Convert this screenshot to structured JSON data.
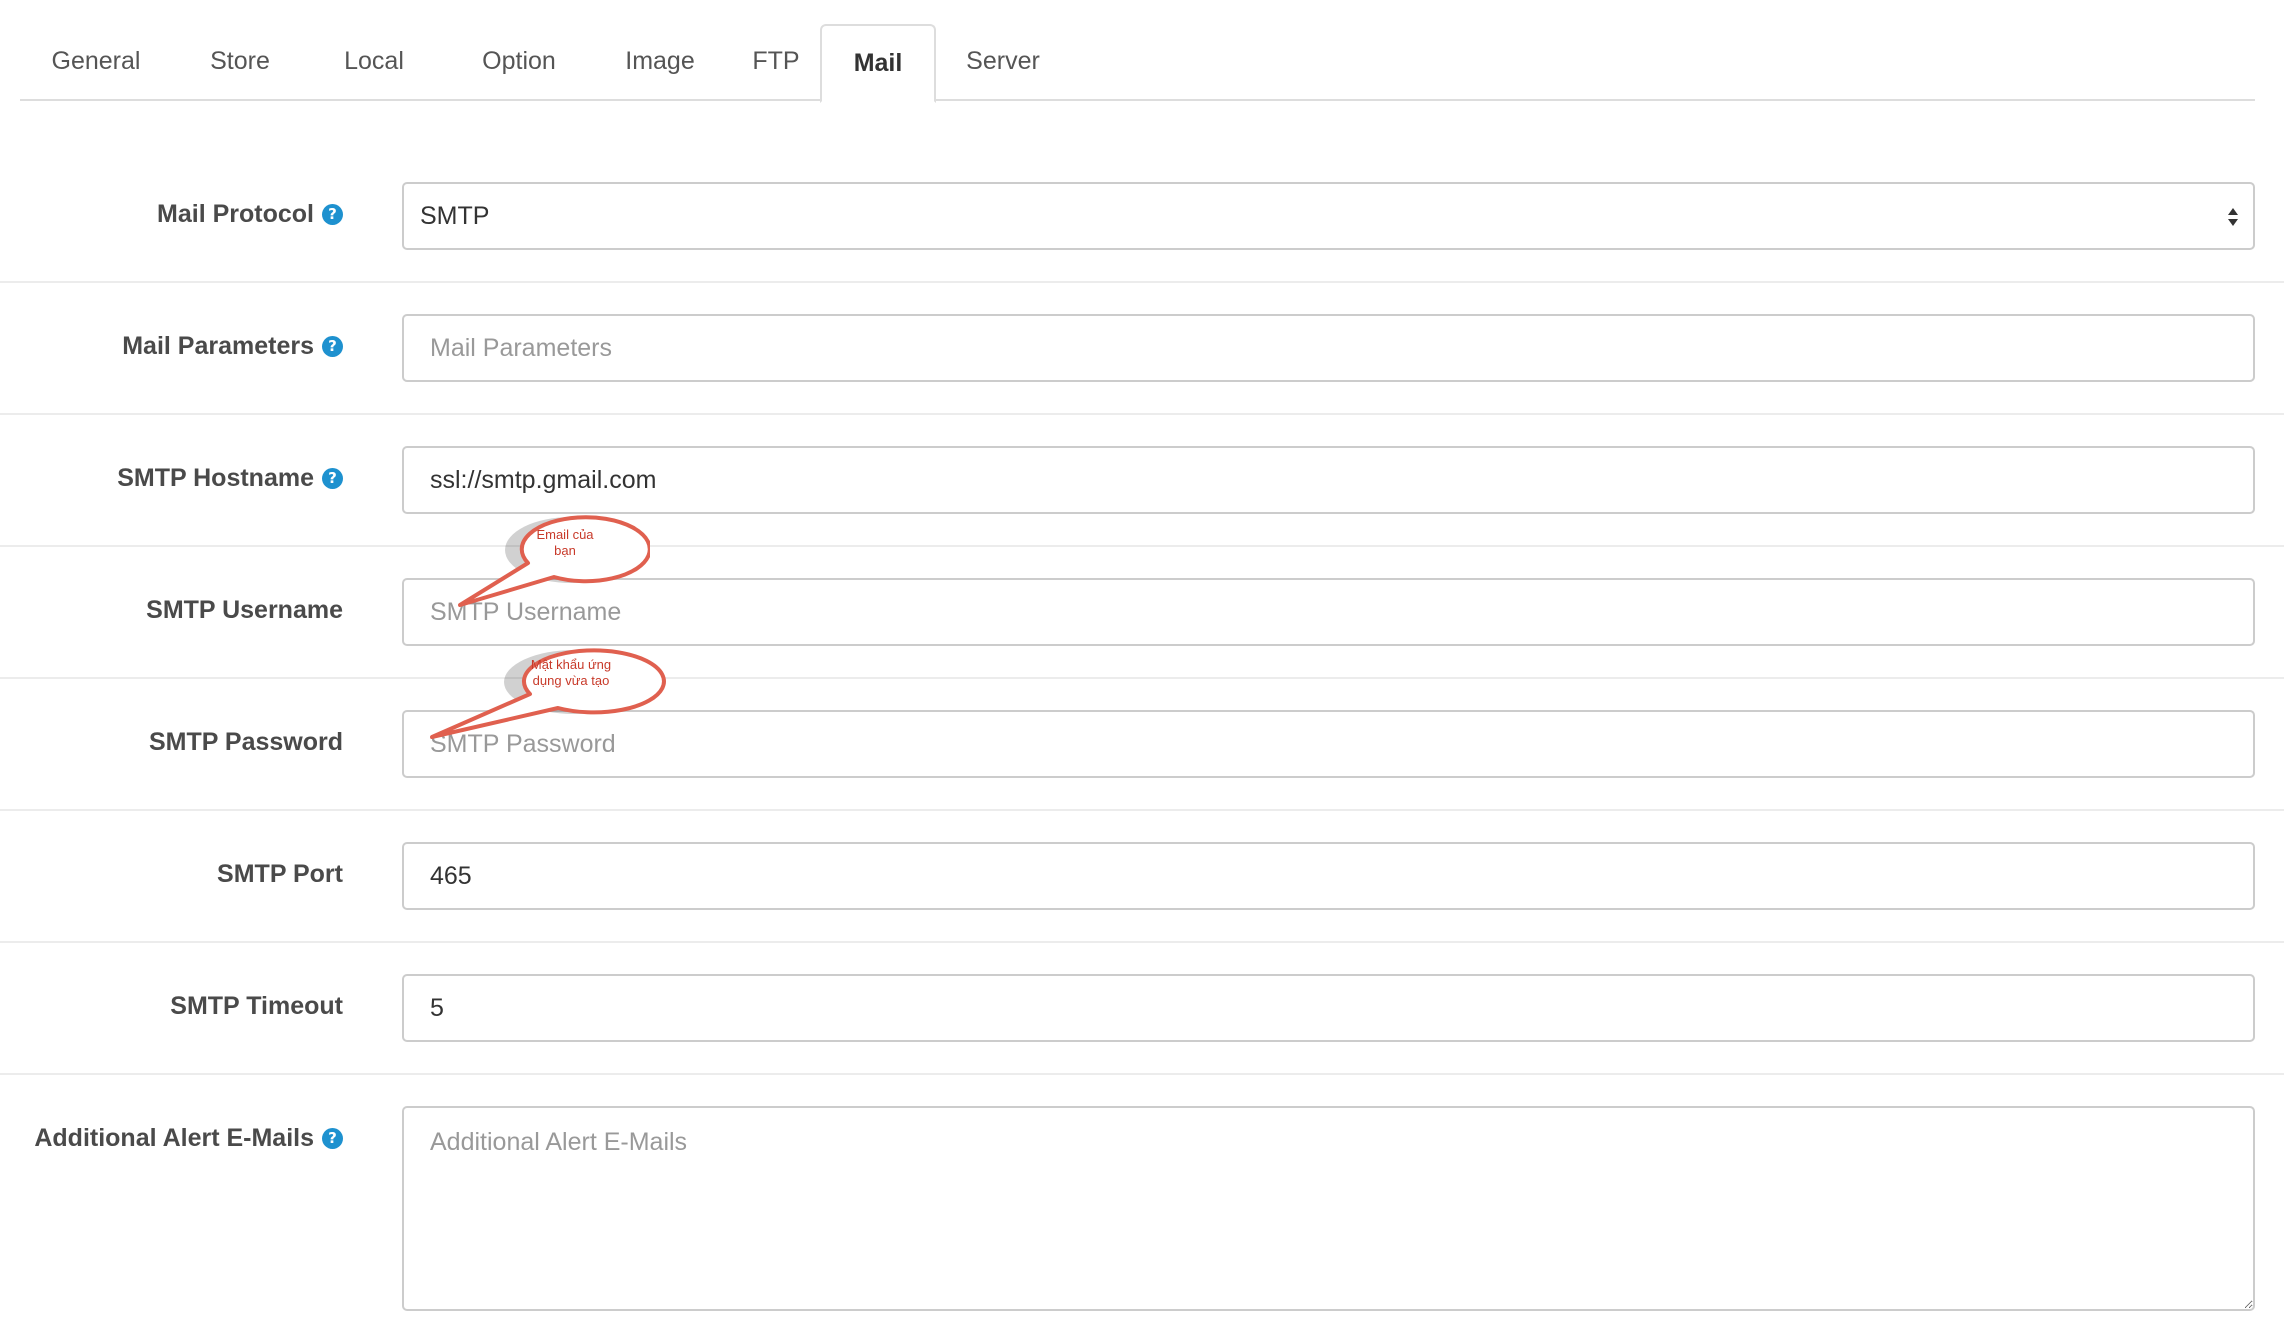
{
  "tabs": [
    {
      "label": "General"
    },
    {
      "label": "Store"
    },
    {
      "label": "Local"
    },
    {
      "label": "Option"
    },
    {
      "label": "Image"
    },
    {
      "label": "FTP"
    },
    {
      "label": "Mail",
      "active": true
    },
    {
      "label": "Server"
    }
  ],
  "form": {
    "mail_protocol": {
      "label": "Mail Protocol",
      "value": "SMTP"
    },
    "mail_parameters": {
      "label": "Mail Parameters",
      "value": "",
      "placeholder": "Mail Parameters"
    },
    "smtp_hostname": {
      "label": "SMTP Hostname",
      "value": "ssl://smtp.gmail.com"
    },
    "smtp_username": {
      "label": "SMTP Username",
      "value": "",
      "placeholder": "SMTP Username"
    },
    "smtp_password": {
      "label": "SMTP Password",
      "value": "",
      "placeholder": "SMTP Password"
    },
    "smtp_port": {
      "label": "SMTP Port",
      "value": "465"
    },
    "smtp_timeout": {
      "label": "SMTP Timeout",
      "value": "5"
    },
    "alert_emails": {
      "label": "Additional Alert E-Mails",
      "value": "",
      "placeholder": "Additional Alert E-Mails"
    }
  },
  "annotations": {
    "username_note_line1": "Email của",
    "username_note_line2": "bạn",
    "password_note_line1": "Mật khẩu ứng",
    "password_note_line2": "dụng vừa tạo"
  },
  "colors": {
    "help_icon": "#1e91cf",
    "callout_stroke": "#e0604f",
    "callout_text": "#c83a2a"
  },
  "help_icon_glyph": "?"
}
